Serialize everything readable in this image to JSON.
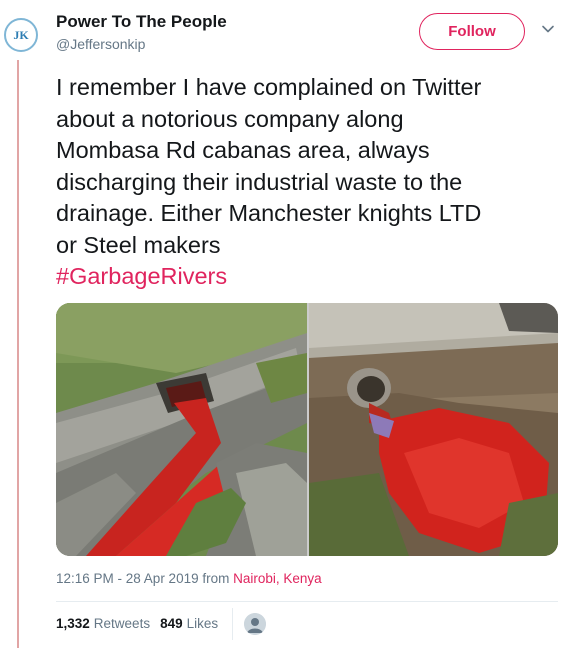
{
  "author": {
    "avatar_text": "JK",
    "name": "Power To The People",
    "handle": "@Jeffersonkip"
  },
  "follow_label": "Follow",
  "tweet": {
    "lines": [
      "I remember I have complained on Twitter",
      "about a notorious company along",
      "Mombasa Rd cabanas area, always",
      "discharging their industrial waste to the",
      "drainage. Either Manchester knights LTD",
      "or Steel makers"
    ],
    "hashtag": "#GarbageRivers"
  },
  "meta": {
    "time_date": "12:16 PM - 28 Apr 2019 from",
    "location": "Nairobi, Kenya"
  },
  "stats": {
    "retweets_count": "1,332",
    "retweets_label": "Retweets",
    "likes_count": "849",
    "likes_label": "Likes"
  },
  "colors": {
    "accent": "#e0245e",
    "text": "#14171a",
    "muted": "#657786"
  }
}
